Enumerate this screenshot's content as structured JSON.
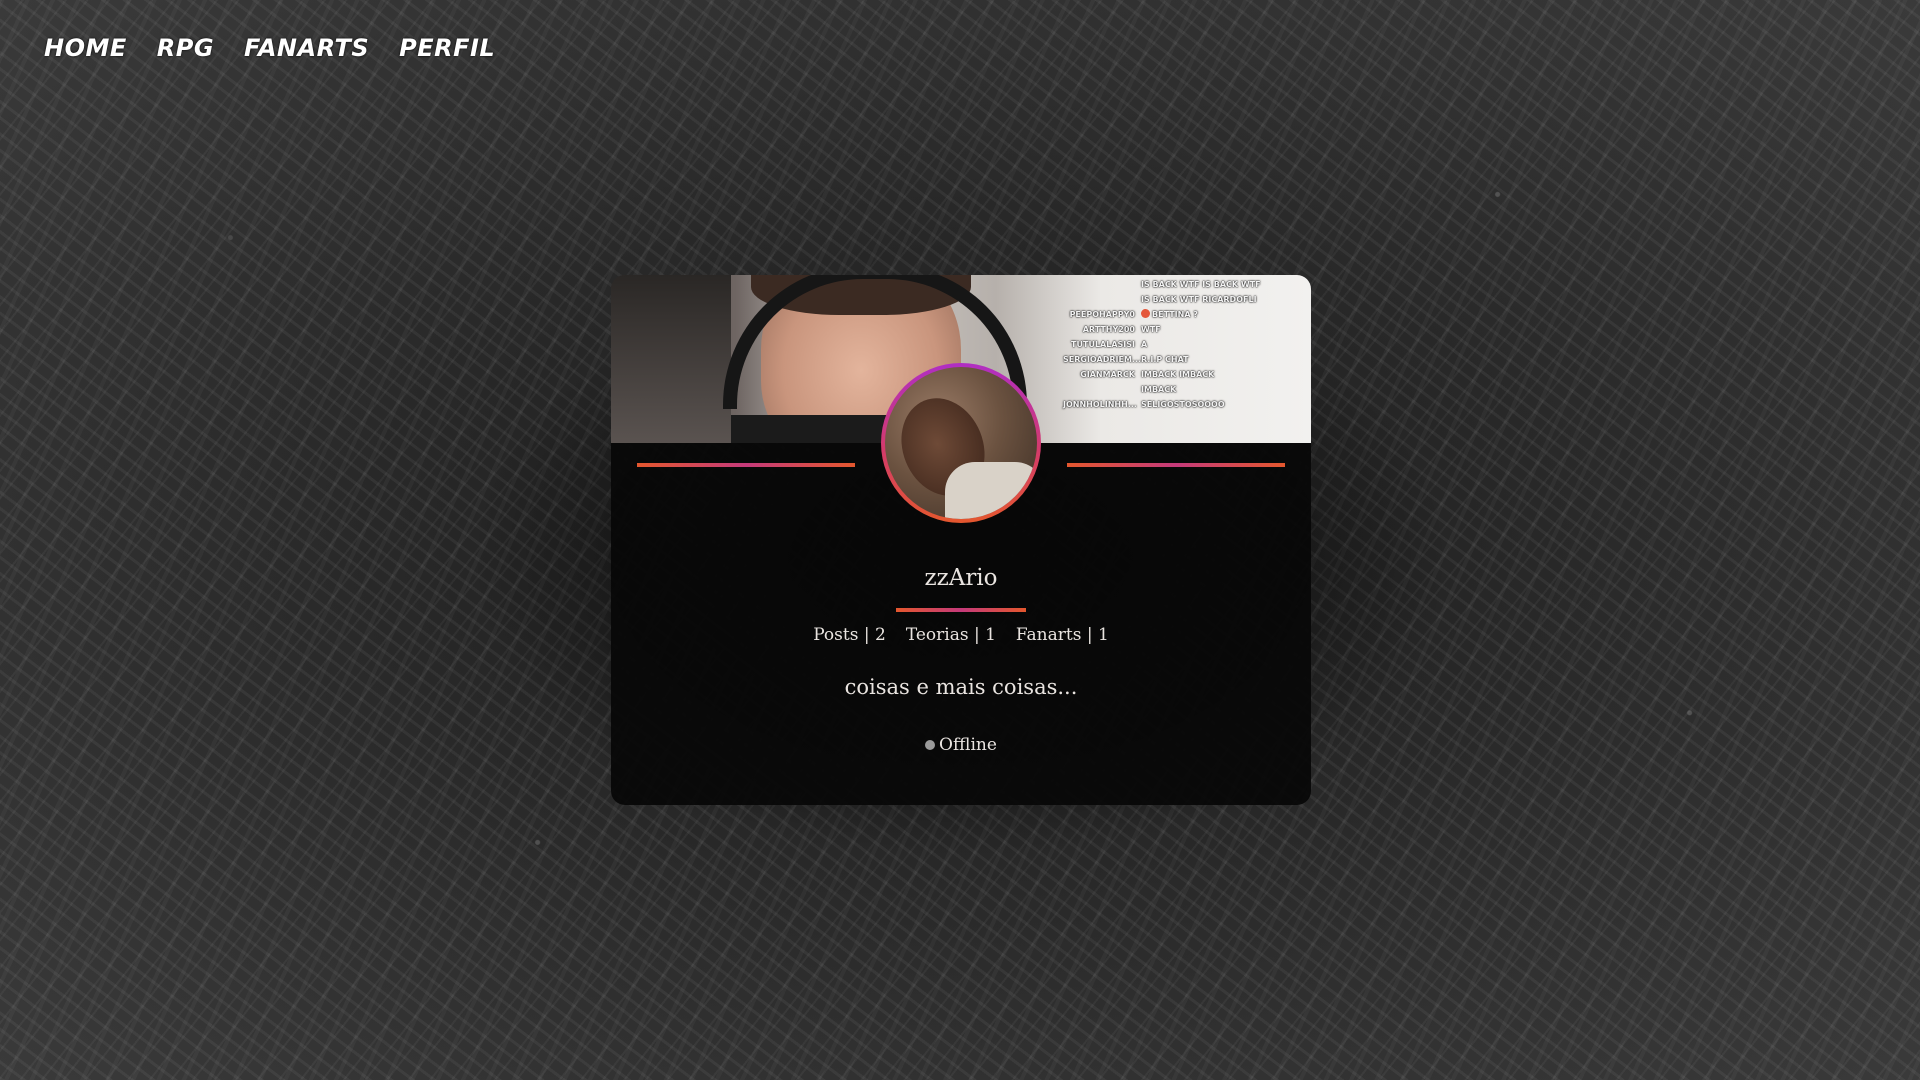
{
  "nav": {
    "items": [
      {
        "label": "HOME"
      },
      {
        "label": "RPG"
      },
      {
        "label": "FANARTS"
      },
      {
        "label": "PERFIL"
      }
    ]
  },
  "profile": {
    "username": "zzArio",
    "stats": [
      {
        "label": "Posts | 2"
      },
      {
        "label": "Teorias | 1"
      },
      {
        "label": "Fanarts | 1"
      }
    ],
    "bio": "coisas e mais coisas...",
    "status": {
      "label": "Offline",
      "color": "#9a9a9a"
    }
  },
  "banner": {
    "chat": [
      {
        "who": "",
        "msg": "IS BACK WTF  IS BACK WTF"
      },
      {
        "who": "",
        "msg": "IS BACK WTF RICARDOFLI"
      },
      {
        "who": "PEEPOHAPPY0",
        "msg": "BETTINA ?"
      },
      {
        "who": "ARTTHY200",
        "msg": "WTF"
      },
      {
        "who": "TUTULALASISI",
        "msg": "A"
      },
      {
        "who": "SERGIOADRIEM...",
        "msg": "R.I.P CHAT"
      },
      {
        "who": "GIANMARCK",
        "msg": "IMBACK  IMBACK"
      },
      {
        "who": "",
        "msg": "IMBACK"
      },
      {
        "who": "JONNHOLINHH...",
        "msg": "SELIGOSTOSOOOO"
      }
    ]
  },
  "colors": {
    "accent_orange": "#e4572e",
    "accent_magenta": "#c53a7a",
    "accent_purple": "#b02ec4"
  }
}
